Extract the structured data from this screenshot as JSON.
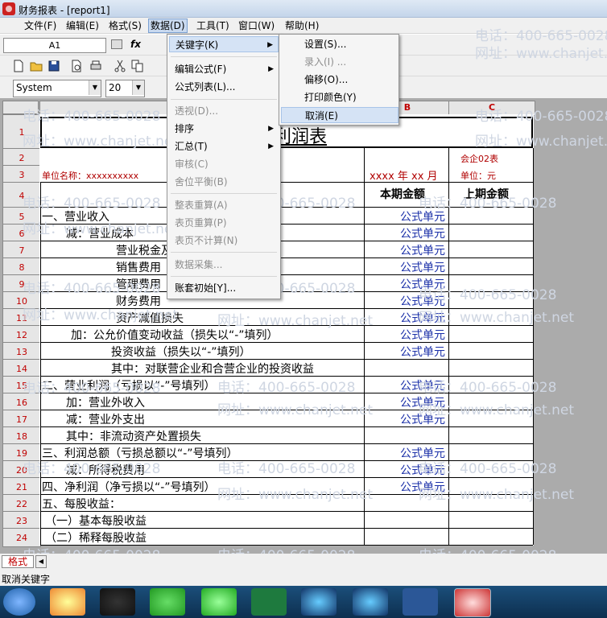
{
  "window": {
    "title": "财务报表 - [report1]"
  },
  "menubar": [
    "文件(F)",
    "编辑(E)",
    "格式(S)",
    "数据(D)",
    "工具(T)",
    "窗口(W)",
    "帮助(H)"
  ],
  "formula_bar": {
    "cell_ref": "A1",
    "fx": "fx"
  },
  "toolbar2": {
    "font": "System",
    "size": "20"
  },
  "columns": [
    "A",
    "B",
    "C"
  ],
  "rows": [
    "1",
    "2",
    "3",
    "4",
    "5",
    "6",
    "7",
    "8",
    "9",
    "10",
    "11",
    "12",
    "13",
    "14",
    "15",
    "16",
    "17",
    "18",
    "19",
    "20",
    "21",
    "22",
    "23",
    "24"
  ],
  "report": {
    "title": "利润表",
    "form_no": "会企02表",
    "unit_name": "单位名称：xxxxxxxxxx",
    "date": "xxxx 年 xx 月",
    "unit": "单位：元",
    "col_current": "本期金额",
    "col_prior": "上期金额",
    "formula_cell": "公式单元",
    "items": [
      "一、营业收入",
      "减：营业成本",
      "营业税金及附加",
      "销售费用",
      "管理费用",
      "财务费用",
      "资产减值损失",
      "加：公允价值变动收益（损失以“-”填列）",
      "投资收益（损失以“-”填列）",
      "其中：对联营企业和合营企业的投资收益",
      "二、营业利润（亏损以“-”号填列）",
      "加：营业外收入",
      "减：营业外支出",
      "其中：非流动资产处置损失",
      "三、利润总额（亏损总额以“-”号填列）",
      "减：所得税费用",
      "四、净利润（净亏损以“-”号填列）",
      "五、每股收益：",
      "（一）基本每股收益",
      "（二）稀释每股收益"
    ]
  },
  "data_menu": {
    "items": [
      "关键字(K)",
      "编辑公式(F)",
      "公式列表(L)...",
      "透视(D)...",
      "排序",
      "汇总(T)",
      "审核(C)",
      "舍位平衡(B)",
      "整表重算(A)",
      "表页重算(P)",
      "表页不计算(N)",
      "数据采集...",
      "账套初始[Y]..."
    ]
  },
  "keyword_menu": {
    "items": [
      "设置(S)...",
      "录入(I) ...",
      "偏移(O)...",
      "打印颜色(Y)",
      "取消(E)"
    ]
  },
  "sheet_tab": "格式",
  "status": "取消关键字",
  "watermark": {
    "phone": "电话：400-665-0028",
    "site": "网址：www.chanjet.net"
  }
}
